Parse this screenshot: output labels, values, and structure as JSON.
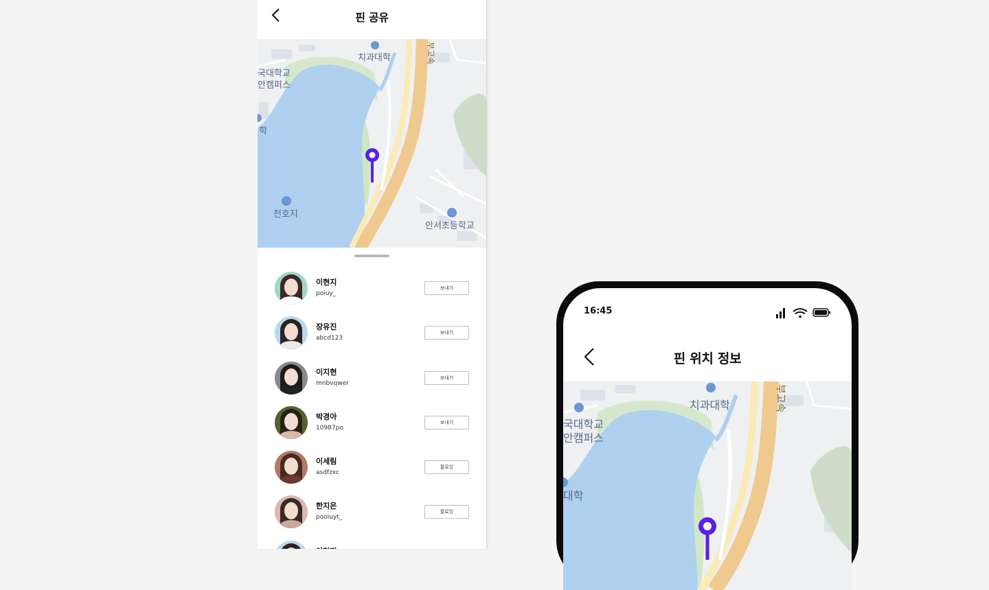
{
  "share_screen": {
    "title": "핀 공유",
    "map_labels": {
      "dental_college": "치과대학",
      "campus_line1": "국대학교",
      "campus_line2": "안캠퍼스",
      "partial_college": "학",
      "lake": "천호지",
      "elementary_school": "안서초등학교",
      "expressway": "부고속"
    },
    "friends": [
      {
        "name": "이현지",
        "id": "poiuy_",
        "action": "보내기",
        "hair": "#3a2a22",
        "bg": "#9fd6c8",
        "cloth": "#ffffff"
      },
      {
        "name": "장유진",
        "id": "abcd123",
        "action": "보내기",
        "hair": "#2b2320",
        "bg": "#b9d7ef",
        "cloth": "#eaeaea"
      },
      {
        "name": "이지현",
        "id": "mnbvqwer",
        "action": "보내기",
        "hair": "#1c1c1c",
        "bg": "#8a8a8a",
        "cloth": "#222222"
      },
      {
        "name": "박경아",
        "id": "10987po",
        "action": "보내기",
        "hair": "#2a2018",
        "bg": "#54632f",
        "cloth": "#d9b8a8"
      },
      {
        "name": "이세림",
        "id": "asdfzxc",
        "action": "팔로잉",
        "hair": "#4a2a20",
        "bg": "#b07a68",
        "cloth": "#6a3a2e"
      },
      {
        "name": "한지은",
        "id": "pooiuyt_",
        "action": "팔로잉",
        "hair": "#3a2a24",
        "bg": "#d8b8b0",
        "cloth": "#c9a89c"
      },
      {
        "name": "이현지",
        "id": "",
        "action": "",
        "hair": "#2b2320",
        "bg": "#b9d7ef",
        "cloth": "#eaeaea"
      }
    ]
  },
  "pin_info_screen": {
    "status_time": "16:45",
    "title": "핀 위치 정보",
    "map_labels": {
      "dental_college": "치과대학",
      "campus_line1": "국대학교",
      "campus_line2": "안캠퍼스",
      "partial_college": "대학",
      "expressway": "부고속"
    }
  },
  "colors": {
    "pin": "#5b1fe8",
    "lake": "#afd0ee",
    "road": "#f0c98e",
    "road_light": "#fbeab3",
    "park": "#cfe8c4"
  }
}
